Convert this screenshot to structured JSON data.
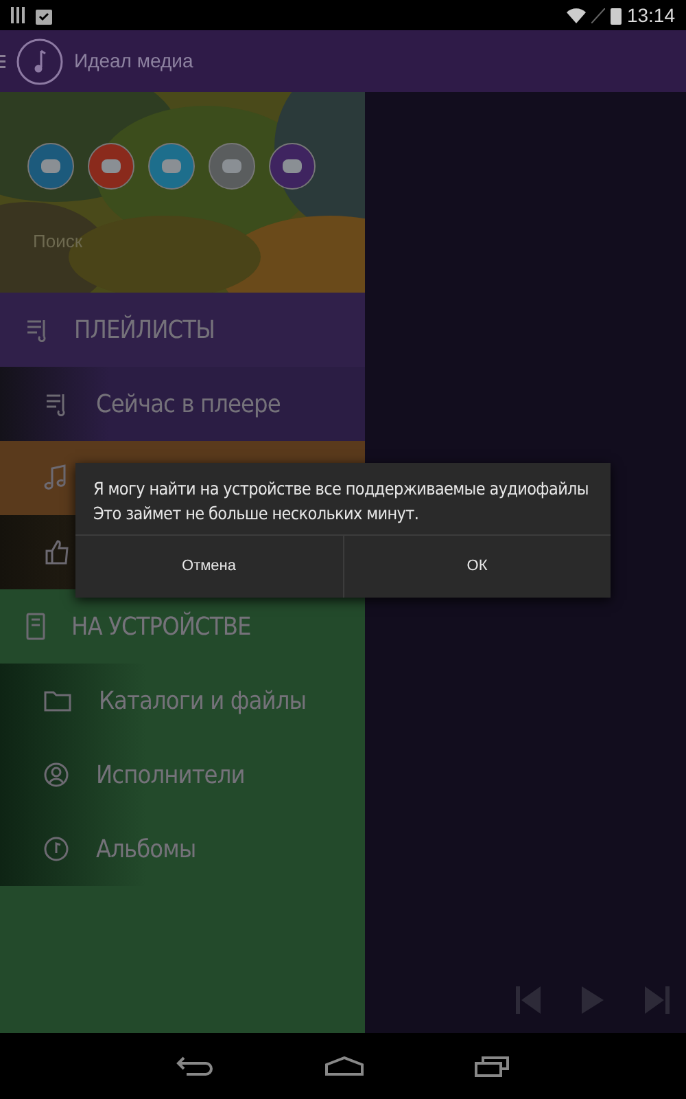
{
  "status_bar": {
    "time": "13:14"
  },
  "toolbar": {
    "title": "Идеал медиа"
  },
  "drawer": {
    "search": {
      "placeholder": "Поиск"
    },
    "rows": [
      {
        "kind": "header",
        "label": "ПЛЕЙЛИСТЫ"
      },
      {
        "kind": "item",
        "label": "Сейчас в плеере"
      },
      {
        "kind": "item"
      },
      {
        "kind": "item"
      },
      {
        "kind": "header",
        "label": "НА УСТРОЙСТВЕ"
      },
      {
        "kind": "item",
        "label": "Каталоги и файлы"
      },
      {
        "kind": "item",
        "label": "Исполнители"
      },
      {
        "kind": "item",
        "label": "Альбомы"
      }
    ]
  },
  "dialog": {
    "message": [
      "Я могу найти на устройстве все поддерживаемые аудиофайлы",
      "Это займет не больше нескольких минут."
    ],
    "buttons": [
      "Отмена",
      "ОК"
    ]
  }
}
